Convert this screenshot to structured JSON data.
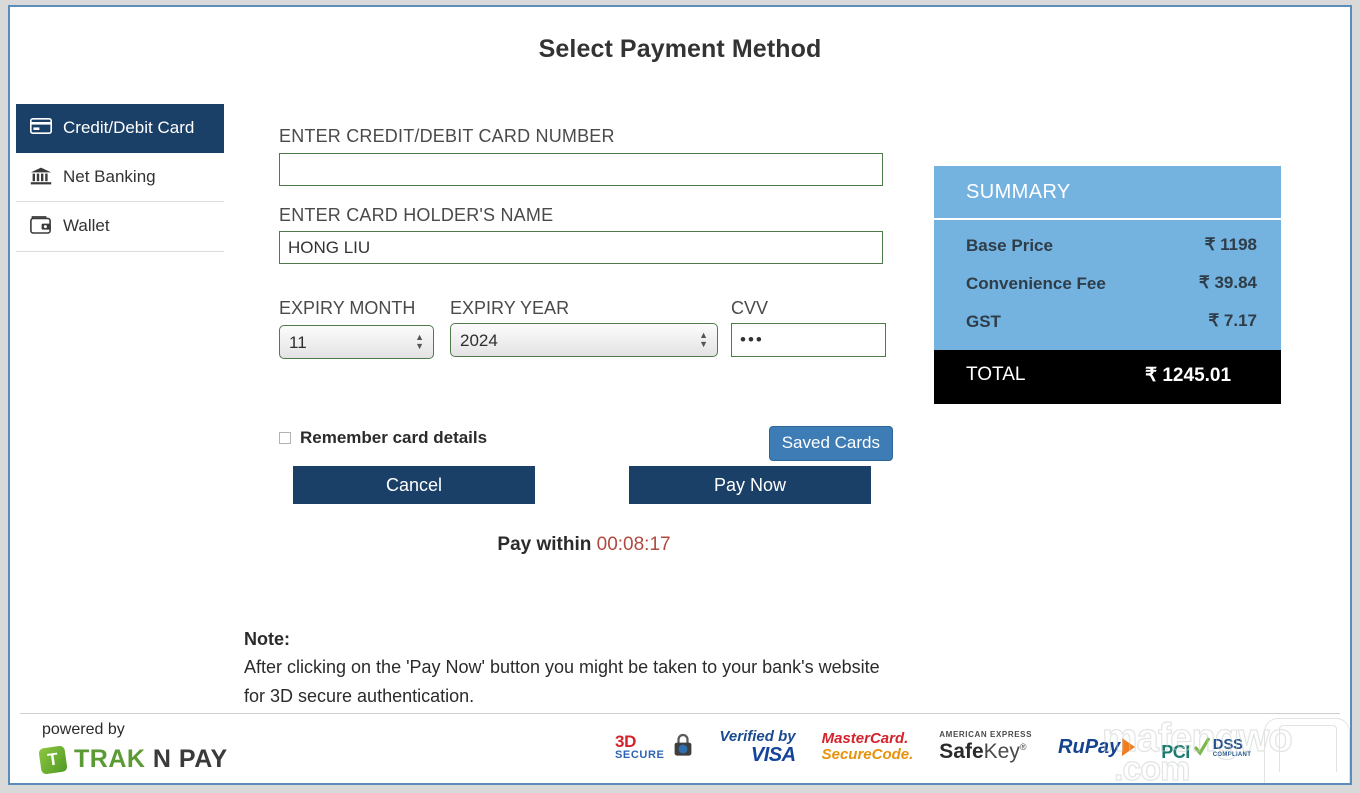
{
  "page": {
    "title": "Select Payment Method"
  },
  "sidebar": {
    "items": [
      {
        "label": "Credit/Debit Card",
        "icon": "credit-card-icon",
        "active": true
      },
      {
        "label": "Net Banking",
        "icon": "bank-icon",
        "active": false
      },
      {
        "label": "Wallet",
        "icon": "wallet-icon",
        "active": false
      }
    ]
  },
  "form": {
    "card_number_label": "ENTER CREDIT/DEBIT CARD NUMBER",
    "card_number_value": "",
    "card_number_placeholder": "",
    "card_holder_label": "ENTER CARD HOLDER'S NAME",
    "card_holder_value": "HONG LIU",
    "expiry_month_label": "EXPIRY MONTH",
    "expiry_month_value": "11",
    "expiry_year_label": "EXPIRY YEAR",
    "expiry_year_value": "2024",
    "cvv_label": "CVV",
    "cvv_value": "•••",
    "remember_label": "Remember card details",
    "remember_checked": false,
    "saved_cards_label": "Saved Cards",
    "cancel_label": "Cancel",
    "pay_now_label": "Pay Now",
    "timer_label": "Pay within",
    "timer_value": "00:08:17"
  },
  "note": {
    "heading": "Note:",
    "body": "After clicking on the 'Pay Now' button you might be taken to your bank's website for 3D secure authentication."
  },
  "summary": {
    "heading": "SUMMARY",
    "rows": [
      {
        "label": "Base Price",
        "value": "₹ 1198"
      },
      {
        "label": "Convenience Fee",
        "value": "₹ 39.84"
      },
      {
        "label": "GST",
        "value": "₹ 7.17"
      }
    ],
    "total_label": "TOTAL",
    "total_value": "₹ 1245.01"
  },
  "footer": {
    "powered_by": "powered by",
    "brand_mark": "T",
    "brand_part1": "TRAK",
    "brand_part2": "N",
    "brand_part3": "PAY",
    "badges": {
      "threed_line1": "3D",
      "threed_line2": "SECURE",
      "visa_line1": "Verified by",
      "visa_line2": "VISA",
      "mc_line1": "MasterCard.",
      "mc_line2": "SecureCode.",
      "amex_line1": "AMERICAN EXPRESS",
      "amex_line2a": "Safe",
      "amex_line2b": "Key",
      "rupay_text": "RuPay",
      "pci_line1": "PCI",
      "pci_line2": "DSS",
      "pci_line3": "COMPLIANT"
    },
    "watermark_line1": "mafengwo",
    "watermark_line2": ".com"
  },
  "colors": {
    "accent_dark_blue": "#1b4068",
    "panel_border_blue": "#5b8db8",
    "summary_blue": "#74b2e0",
    "total_black": "#000000",
    "input_border_green": "#4f7a4a",
    "timer_red": "#b04a40",
    "saved_cards_blue": "#3e7cb6"
  }
}
